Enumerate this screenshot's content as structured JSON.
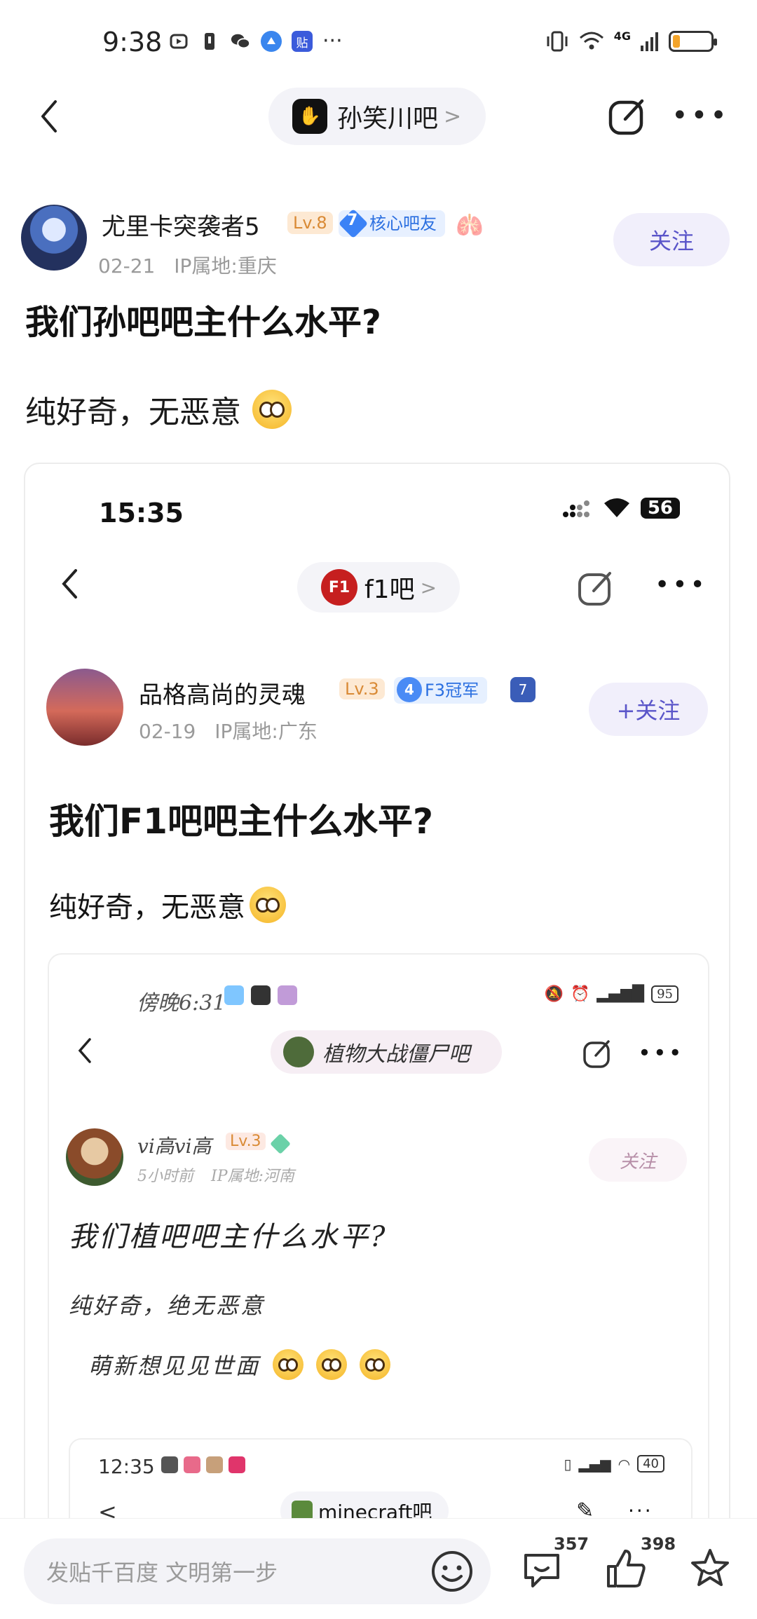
{
  "status_bar": {
    "time": "9:38",
    "left_icons": [
      "alarm-icon",
      "notification-icon",
      "wechat-icon",
      "browser-icon",
      "tieba-icon"
    ],
    "more": "···",
    "network": "4G",
    "battery_level": 0.2,
    "battery_color": "#f3a42a"
  },
  "nav": {
    "forum_name": "孙笑川吧",
    "forum_chevron": ">"
  },
  "post": {
    "author": "尤里卡突袭者5",
    "level": "Lv.8",
    "badge_number": "7",
    "badge_text": "核心吧友",
    "date": "02-21",
    "ip": "IP属地:重庆",
    "follow_label": "关注",
    "title": "我们孙吧吧主什么水平?",
    "body": "纯好奇，无恶意"
  },
  "embedded_1": {
    "time": "15:35",
    "battery": "56",
    "forum_name": "f1吧",
    "forum_chevron": ">",
    "author": "品格高尚的灵魂",
    "level": "Lv.3",
    "badge_number": "4",
    "badge_text": "F3冠军",
    "rank_number": "7",
    "date": "02-19",
    "ip": "IP属地:广东",
    "follow_label": "+关注",
    "title": "我们F1吧吧主什么水平?",
    "body": "纯好奇，无恶意"
  },
  "embedded_2": {
    "time": "傍晚6:31",
    "battery": "95",
    "forum_name": "植物大战僵尸吧",
    "author": "vi高vi高",
    "level": "Lv.3",
    "date": "5小时前",
    "ip": "IP属地:河南",
    "follow_label": "关注",
    "title": "我们植吧吧主什么水平?",
    "body_line1": "纯好奇，绝无恶意",
    "body_line2": "萌新想见见世面"
  },
  "embedded_3": {
    "time": "12:35",
    "battery": "40",
    "forum_name": "minecraft吧",
    "back": "<",
    "more": "···"
  },
  "bottom_bar": {
    "input_placeholder": "发贴千百度 文明第一步",
    "comment_count": "357",
    "like_count": "398"
  },
  "colors": {
    "accent": "#5a55c9",
    "follow_bg": "#f1effb",
    "level_bg": "#fde9d3",
    "level_text": "#d98a35",
    "badge_blue": "#2b6fe0"
  }
}
